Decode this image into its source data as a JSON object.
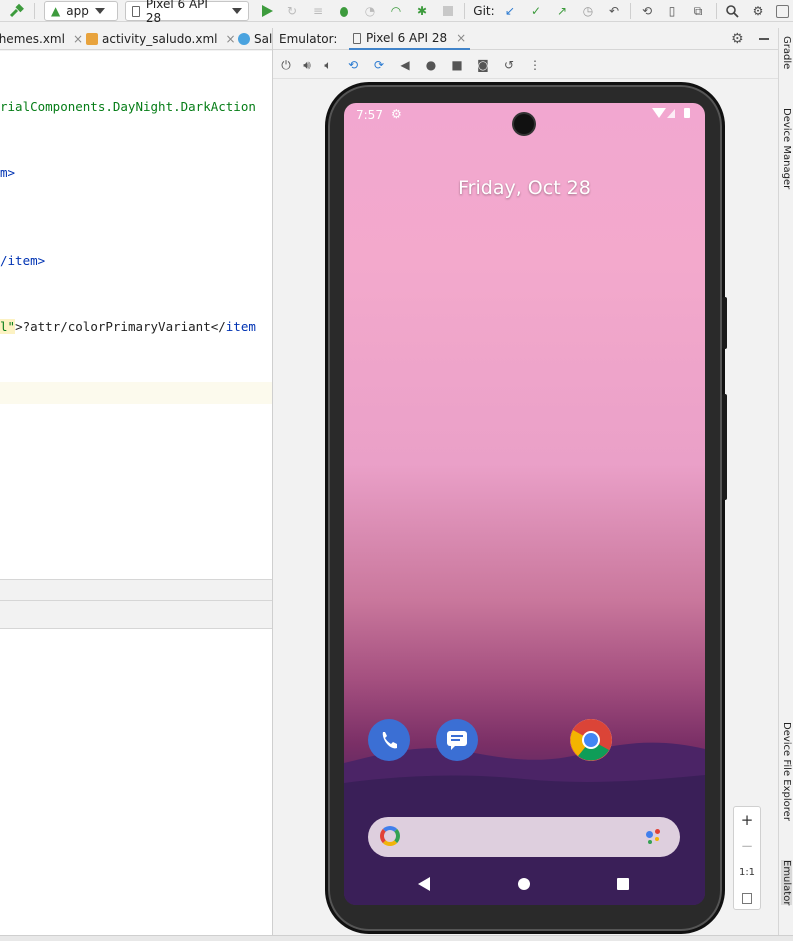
{
  "toolbar": {
    "config_label": "app",
    "device_label": "Pixel 6 API 28",
    "git_label": "Git:"
  },
  "editor_tabs": [
    {
      "label": "themes.xml"
    },
    {
      "label": "activity_saludo.xml"
    },
    {
      "label": "Sal"
    }
  ],
  "editor_lines": {
    "line1": "rialComponents.DayNight.DarkAction",
    "line2": "m>",
    "line3": "/item>",
    "line4_prefix": "l\"",
    "line4_body": ">?attr/colorPrimaryVariant</",
    "line4_tag": "item"
  },
  "emulator": {
    "header_label": "Emulator:",
    "tab_label": "Pixel 6 API 28"
  },
  "phone": {
    "time": "7:57",
    "date": "Friday, Oct 28"
  },
  "zoom": {
    "plus": "+",
    "minus": "−",
    "one_to_one": "1:1"
  },
  "right_strip": {
    "gradle": "Gradle",
    "device_manager": "Device Manager",
    "device_file_explorer": "Device File Explorer",
    "emulator": "Emulator"
  },
  "colors": {
    "accent_green": "#3d9b3d",
    "xml_string": "#067d17",
    "xml_tag": "#0033b3"
  }
}
